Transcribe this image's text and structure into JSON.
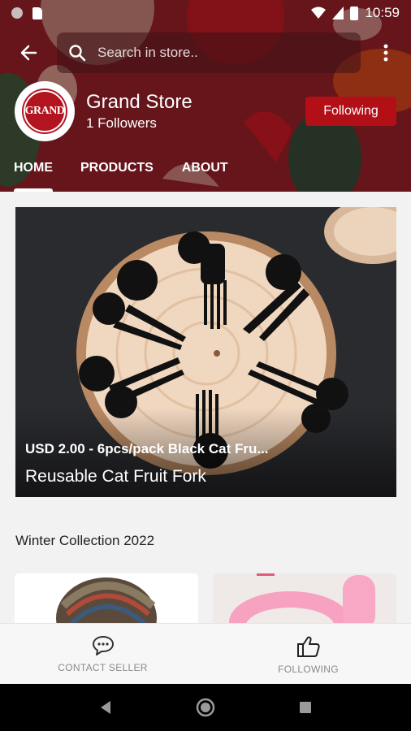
{
  "status_bar": {
    "time": "10:59"
  },
  "search": {
    "placeholder": "Search in store.."
  },
  "store": {
    "logo_text": "GRAND",
    "name": "Grand Store",
    "followers": "1 Followers",
    "follow_button": "Following"
  },
  "tabs": [
    {
      "label": "HOME",
      "active": true
    },
    {
      "label": "PRODUCTS",
      "active": false
    },
    {
      "label": "ABOUT",
      "active": false
    }
  ],
  "promo": {
    "price_line": "USD 2.00 - 6pcs/pack Black Cat Fru...",
    "title": "Reusable Cat Fruit Fork"
  },
  "section": {
    "title": "Winter Collection 2022"
  },
  "bottom_nav": [
    {
      "label": "CONTACT SELLER",
      "icon": "chat-bubble-icon"
    },
    {
      "label": "FOLLOWING",
      "icon": "thumbs-up-icon"
    }
  ],
  "colors": {
    "brand_red": "#b30f17",
    "banner_red": "#7a1a1f",
    "nav_label": "#8a8a8a"
  }
}
